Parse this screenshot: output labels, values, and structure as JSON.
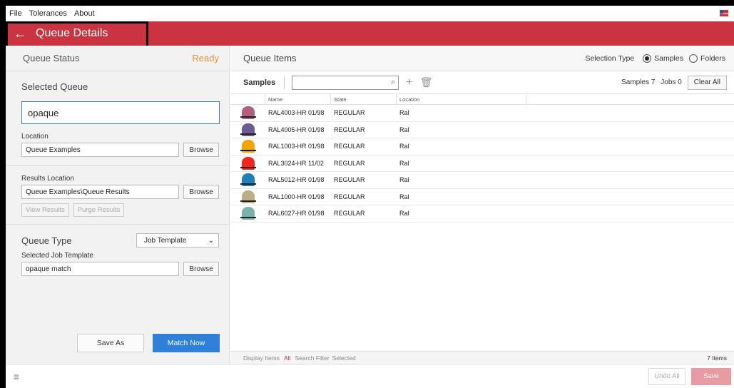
{
  "menu": {
    "items": [
      "File",
      "Tolerances",
      "About"
    ]
  },
  "header": {
    "back_icon": "arrow-left-icon",
    "title": "Queue Details",
    "accent": "#cc3340"
  },
  "left": {
    "queue_status_label": "Queue Status",
    "queue_status_value": "Ready",
    "selected_queue_title": "Selected Queue",
    "selected_queue_value": "opaque",
    "location_label": "Location",
    "location_value": "Queue Examples",
    "browse": "Browse",
    "results_location_label": "Results Location",
    "results_location_value": "Queue Examples\\Queue Results",
    "view_results": "View Results",
    "purge_results": "Purge Results",
    "queue_type_label": "Queue Type",
    "queue_type_value": "Job Template",
    "selected_job_template_label": "Selected Job Template",
    "selected_job_template_value": "opaque match",
    "save_as": "Save As",
    "match_now": "Match Now"
  },
  "right": {
    "queue_items_title": "Queue Items",
    "selection_type_label": "Selection Type",
    "opt_samples": "Samples",
    "opt_folders": "Folders",
    "samples_label": "Samples",
    "samples_count": "Samples 7",
    "jobs_count": "Jobs 0",
    "clear_all": "Clear All",
    "columns": [
      "Name",
      "State",
      "Location"
    ],
    "rows": [
      {
        "name": "RAL4003-HR 01/98",
        "state": "REGULAR",
        "location": "Ral",
        "color": "#b0617f"
      },
      {
        "name": "RAL4005-HR 01/98",
        "state": "REGULAR",
        "location": "Ral",
        "color": "#6e5a92"
      },
      {
        "name": "RAL1003-HR 01/98",
        "state": "REGULAR",
        "location": "Ral",
        "color": "#f2a40a"
      },
      {
        "name": "RAL3024-HR 11/02",
        "state": "REGULAR",
        "location": "Ral",
        "color": "#f1261d"
      },
      {
        "name": "RAL5012-HR 01/98",
        "state": "REGULAR",
        "location": "Ral",
        "color": "#1f7fb8"
      },
      {
        "name": "RAL1000-HR 01/98",
        "state": "REGULAR",
        "location": "Ral",
        "color": "#bcae86"
      },
      {
        "name": "RAL6027-HR 01/98",
        "state": "REGULAR",
        "location": "Ral",
        "color": "#7ab1a8"
      }
    ],
    "footer": {
      "display_items": "Display Items",
      "all": "All",
      "search_filter": "Search Filter",
      "selected": "Selected",
      "items_count": "7 Items"
    }
  },
  "appbar": {
    "undo_all": "Undo All",
    "save": "Save"
  }
}
